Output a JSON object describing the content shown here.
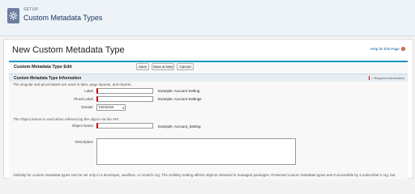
{
  "header": {
    "setup_label": "SETUP",
    "title": "Custom Metadata Types",
    "icon": "gear-icon"
  },
  "page": {
    "title": "New Custom Metadata Type",
    "help_link": "Help for this Page",
    "help_icon": "question-icon"
  },
  "edit_box": {
    "title": "Custom Metadata Type Edit",
    "buttons": {
      "save": "Save",
      "save_new": "Save & New",
      "cancel": "Cancel"
    },
    "section": {
      "title": "Custom Metadata Type Information",
      "required_info": "= Required Information"
    },
    "plural_note": "The singular and plural labels are used in tabs, page layouts, and reports.",
    "fields": {
      "label": {
        "label": "Label",
        "example": "Example:  Account Setting",
        "value": ""
      },
      "plural_label": {
        "label": "Plural Label",
        "example": "Example:  Account Settings",
        "value": ""
      },
      "gender": {
        "label": "Gender",
        "value": "Feminine"
      }
    },
    "object_note": "The Object Name is used when referencing the object via the API.",
    "object_name": {
      "label": "Object Name",
      "example": "Example:  Account_Setting",
      "value": ""
    },
    "description": {
      "label": "Description",
      "value": ""
    },
    "visibility_note": "Visibility for custom metadata types can be set only in a developer, sandbox, or scratch org. The visibility setting affects objects released in managed packages. Protected custom metadata types aren't accessible by a subscriber's org, but"
  },
  "colors": {
    "accent": "#1797c0",
    "required": "#cc0000",
    "link": "#015ba7"
  }
}
